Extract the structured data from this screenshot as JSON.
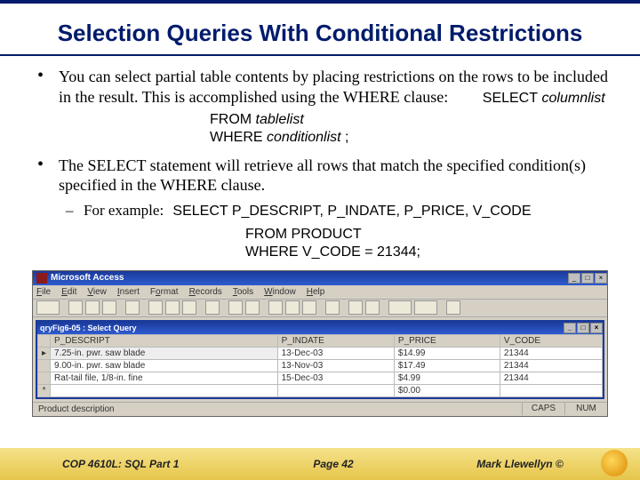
{
  "title": "Selection Queries With Conditional Restrictions",
  "bullets": {
    "b1_text": "You can select partial table contents by placing restrictions on the rows to be included in the result.  This is accomplished using the WHERE clause:",
    "b1_sql_inline": "SELECT",
    "b1_sql_inline_it": "columnlist",
    "b1_sql_l1a": "FROM ",
    "b1_sql_l1b": "tablelist",
    "b1_sql_l2a": "WHERE ",
    "b1_sql_l2b": "conditionlist ",
    "b1_sql_l2c": ";",
    "b2_text": "The SELECT statement will retrieve all rows that match the specified condition(s) specified in the WHERE clause.",
    "sub_label": "For example:",
    "sub_sql": "SELECT P_DESCRIPT, P_INDATE, P_PRICE, V_CODE",
    "sub_sql_l1": "FROM PRODUCT",
    "sub_sql_l2": "WHERE V_CODE = 21344;"
  },
  "access": {
    "app_title": "Microsoft Access",
    "menu": [
      "File",
      "Edit",
      "View",
      "Insert",
      "Format",
      "Records",
      "Tools",
      "Window",
      "Help"
    ],
    "query_title": "qryFig6-05 : Select Query",
    "headers": [
      "P_DESCRIPT",
      "P_INDATE",
      "P_PRICE",
      "V_CODE"
    ],
    "rows": [
      [
        "7.25-in. pwr. saw blade",
        "13-Dec-03",
        "$14.99",
        "21344"
      ],
      [
        "9.00-in. pwr. saw blade",
        "13-Nov-03",
        "$17.49",
        "21344"
      ],
      [
        "Rat-tail file, 1/8-in. fine",
        "15-Dec-03",
        "$4.99",
        "21344"
      ],
      [
        "",
        "",
        "$0.00",
        ""
      ]
    ],
    "status_left": "Product description",
    "status_caps": "CAPS",
    "status_num": "NUM"
  },
  "footer": {
    "course": "COP 4610L: SQL Part 1",
    "page": "Page 42",
    "author": "Mark Llewellyn ©"
  }
}
